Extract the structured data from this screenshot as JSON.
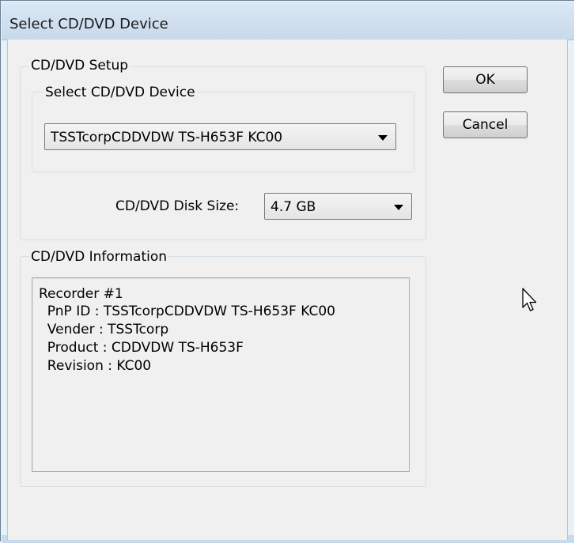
{
  "window": {
    "title": "Select CD/DVD Device"
  },
  "setup_group": {
    "label": "CD/DVD Setup"
  },
  "device_group": {
    "label": "Select CD/DVD Device"
  },
  "device_select": {
    "value": "TSSTcorpCDDVDW TS-H653F KC00"
  },
  "disk_size": {
    "label": "CD/DVD Disk Size:",
    "value": "4.7 GB"
  },
  "buttons": {
    "ok": "OK",
    "cancel": "Cancel"
  },
  "info_group": {
    "label": "CD/DVD Information",
    "lines": [
      "Recorder #1",
      "  PnP ID : TSSTcorpCDDVDW TS-H653F KC00",
      "  Vender : TSSTcorp",
      "  Product : CDDVDW TS-H653F",
      "  Revision : KC00"
    ]
  },
  "icons": {
    "cursor": "mouse-pointer-icon",
    "dropdown": "chevron-down-icon"
  }
}
